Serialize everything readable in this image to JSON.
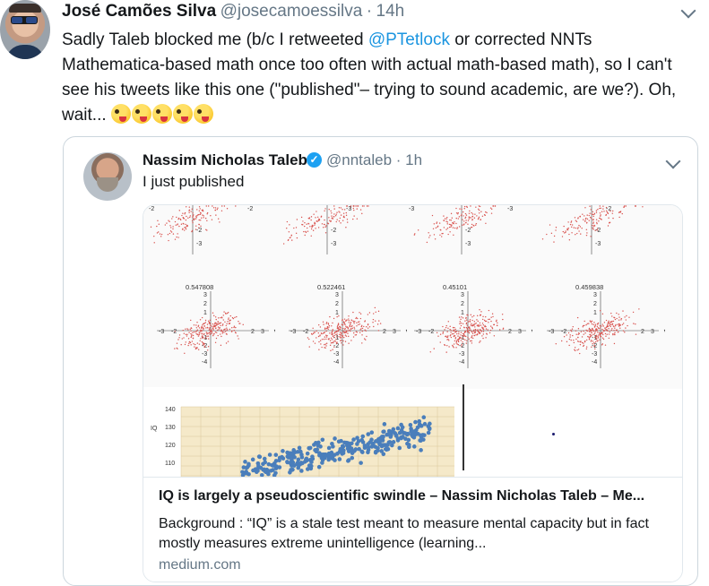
{
  "tweet": {
    "author_name": "José Camões Silva",
    "author_handle": "@josecamoessilva",
    "separator": "·",
    "time": "14h",
    "text_before_link": "Sadly Taleb blocked me (b/c I retweeted ",
    "mention": "@PTetlock",
    "text_after_link": " or corrected NNTs Mathematica-based math once too often with actual math-based math), so I can't see his tweets like this one (\"published\"– trying to sound academic, are we?). Oh, wait...",
    "emoji_icon": "zany-face-emoji",
    "emoji_count": 5
  },
  "quoted": {
    "author_name": "Nassim Nicholas Taleb",
    "author_handle": "@nntaleb",
    "separator": "·",
    "time": "1h",
    "text": "I just published",
    "verified_icon": "verified-badge-icon"
  },
  "plots": {
    "top_row_ticks": [
      "-2",
      "-2",
      "-3",
      "-3",
      "-3",
      "-2"
    ],
    "correlations": [
      "0.547808",
      "0.522461",
      "0.45101",
      "0.459838"
    ],
    "tick_values": [
      "3",
      "2",
      "1",
      "-1",
      "-2",
      "-3",
      "-4"
    ],
    "x_ticks": [
      "-3",
      "-2",
      "2",
      "3",
      "4"
    ]
  },
  "iq_chart": {
    "ylabel": "IQ",
    "y_ticks": [
      "140",
      "130",
      "120",
      "110"
    ],
    "grid_color": "#f5e9c9"
  },
  "card": {
    "title": "IQ is largely a pseudoscientific swindle – Nassim Nicholas Taleb – Me...",
    "description": "Background : “IQ” is a stale test meant to measure mental capacity but in fact mostly measures extreme unintelligence (learning...",
    "domain": "medium.com"
  },
  "colors": {
    "link": "#1b95e0",
    "muted": "#657786",
    "scatter_red": "#d9534f",
    "scatter_blue": "#4a7ebb"
  }
}
